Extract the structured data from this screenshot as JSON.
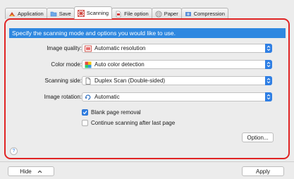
{
  "tabs": [
    {
      "label": "Application",
      "icon": "application-icon"
    },
    {
      "label": "Save",
      "icon": "folder-icon"
    },
    {
      "label": "Scanning",
      "icon": "scanning-icon"
    },
    {
      "label": "File option",
      "icon": "file-option-icon"
    },
    {
      "label": "Paper",
      "icon": "paper-icon"
    },
    {
      "label": "Compression",
      "icon": "compression-icon"
    }
  ],
  "active_tab": "Scanning",
  "banner": "Specify the scanning mode and options you would like to use.",
  "fields": {
    "image_quality": {
      "label": "Image quality:",
      "value": "Automatic resolution"
    },
    "color_mode": {
      "label": "Color mode:",
      "value": "Auto color detection"
    },
    "scanning_side": {
      "label": "Scanning side:",
      "value": "Duplex Scan (Double-sided)"
    },
    "image_rotation": {
      "label": "Image rotation:",
      "value": "Automatic"
    }
  },
  "checkboxes": {
    "blank_page_removal": {
      "label": "Blank page removal",
      "checked": true
    },
    "continue_scanning": {
      "label": "Continue scanning after last page",
      "checked": false
    }
  },
  "buttons": {
    "option": "Option...",
    "hide": "Hide",
    "apply": "Apply"
  },
  "help_label": "?",
  "colors": {
    "accent": "#2f7fe4",
    "banner": "#2f88e0",
    "highlight_border": "#e02424"
  }
}
